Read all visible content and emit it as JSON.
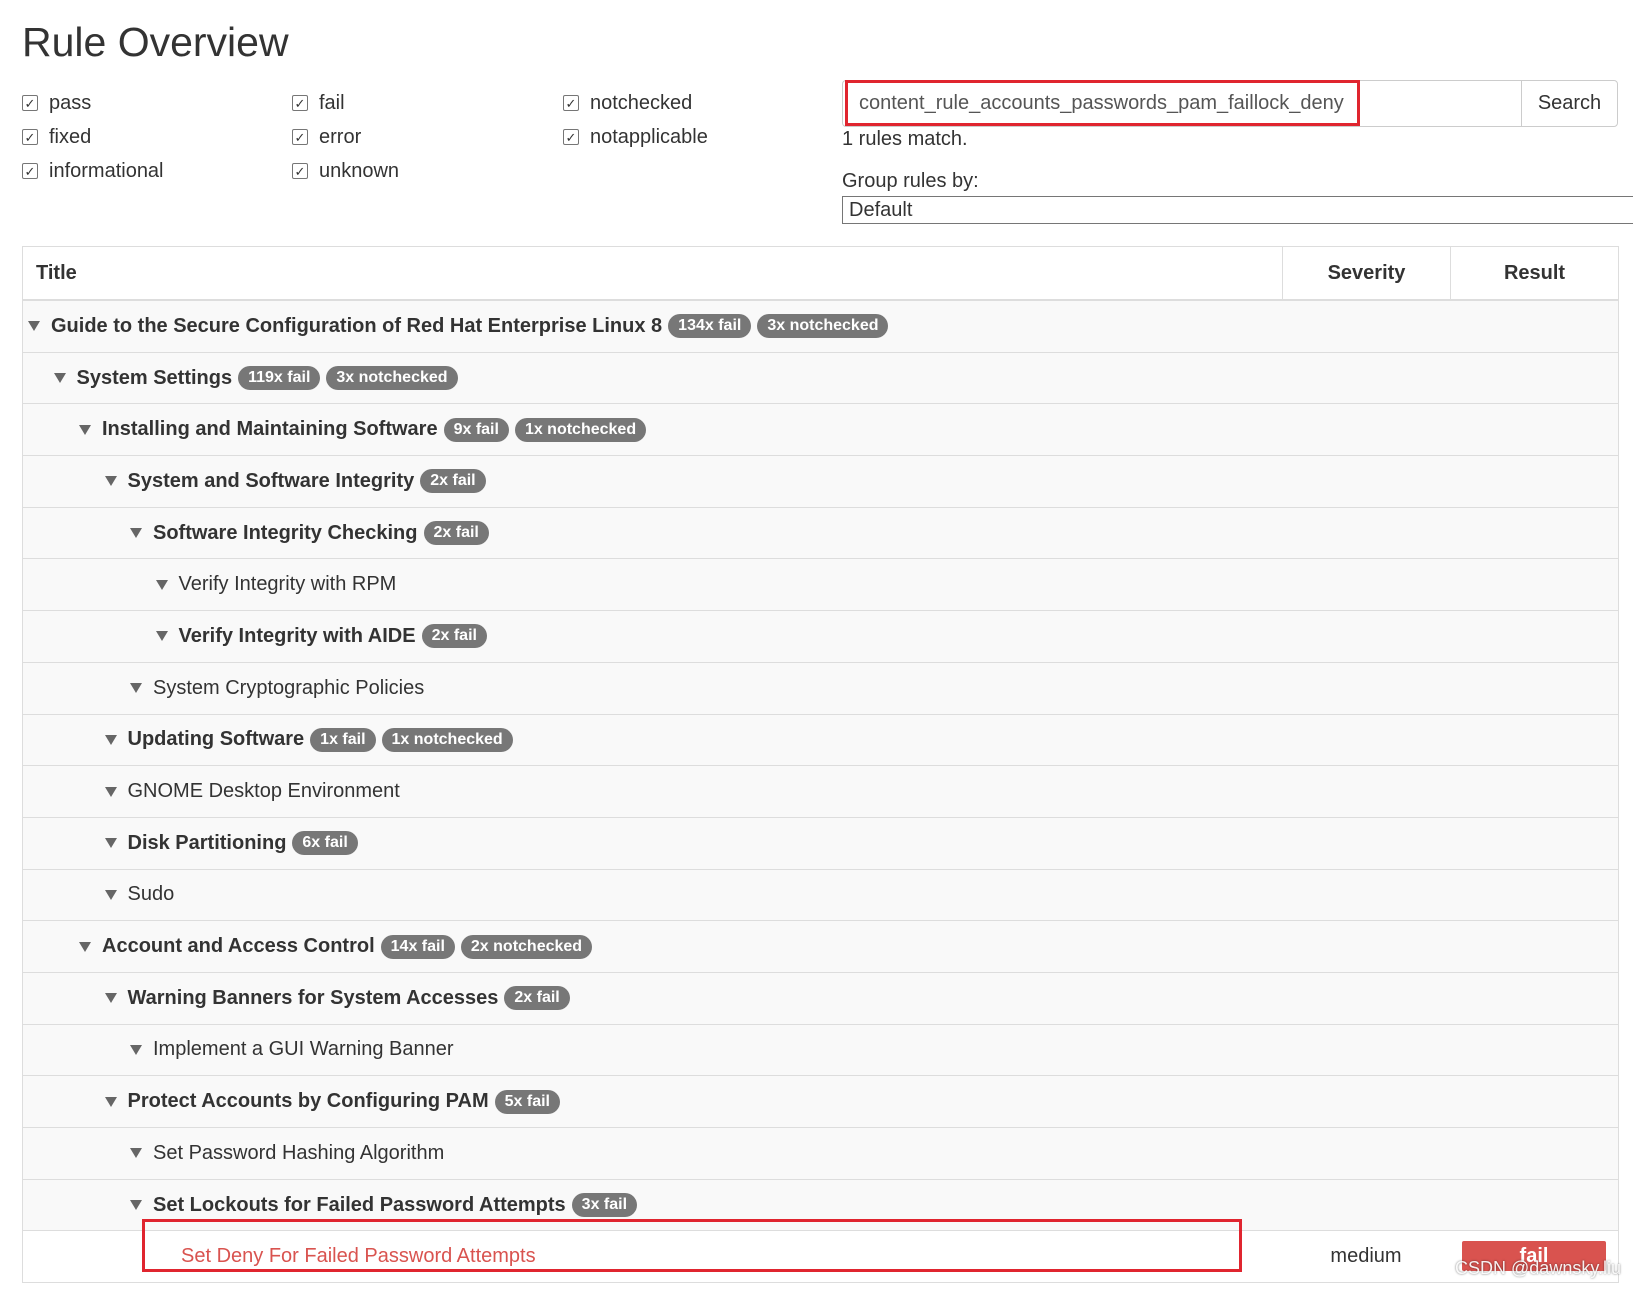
{
  "page_title": "Rule Overview",
  "filters": [
    {
      "label": "pass",
      "checked": true
    },
    {
      "label": "fixed",
      "checked": true
    },
    {
      "label": "informational",
      "checked": true
    },
    {
      "label": "fail",
      "checked": true
    },
    {
      "label": "error",
      "checked": true
    },
    {
      "label": "unknown",
      "checked": true
    },
    {
      "label": "notchecked",
      "checked": true
    },
    {
      "label": "notapplicable",
      "checked": true
    }
  ],
  "search": {
    "value": "content_rule_accounts_passwords_pam_faillock_deny",
    "button_label": "Search",
    "match_count": "1 rules match."
  },
  "group_by": {
    "label": "Group rules by:",
    "value": "Default"
  },
  "table": {
    "headers": {
      "title": "Title",
      "severity": "Severity",
      "result": "Result"
    },
    "groups": [
      {
        "label": "Guide to the Secure Configuration of Red Hat Enterprise Linux 8",
        "depth": 0,
        "bold": true,
        "badges": [
          "134x fail",
          "3x notchecked"
        ]
      },
      {
        "label": "System Settings",
        "depth": 1,
        "bold": true,
        "badges": [
          "119x fail",
          "3x notchecked"
        ]
      },
      {
        "label": "Installing and Maintaining Software",
        "depth": 2,
        "bold": true,
        "badges": [
          "9x fail",
          "1x notchecked"
        ]
      },
      {
        "label": "System and Software Integrity",
        "depth": 3,
        "bold": true,
        "badges": [
          "2x fail"
        ]
      },
      {
        "label": "Software Integrity Checking",
        "depth": 4,
        "bold": true,
        "badges": [
          "2x fail"
        ]
      },
      {
        "label": "Verify Integrity with RPM",
        "depth": 5,
        "bold": false,
        "badges": []
      },
      {
        "label": "Verify Integrity with AIDE",
        "depth": 5,
        "bold": true,
        "badges": [
          "2x fail"
        ]
      },
      {
        "label": "System Cryptographic Policies",
        "depth": 4,
        "bold": false,
        "badges": []
      },
      {
        "label": "Updating Software",
        "depth": 3,
        "bold": true,
        "badges": [
          "1x fail",
          "1x notchecked"
        ]
      },
      {
        "label": "GNOME Desktop Environment",
        "depth": 3,
        "bold": false,
        "badges": []
      },
      {
        "label": "Disk Partitioning",
        "depth": 3,
        "bold": true,
        "badges": [
          "6x fail"
        ]
      },
      {
        "label": "Sudo",
        "depth": 3,
        "bold": false,
        "badges": []
      },
      {
        "label": "Account and Access Control",
        "depth": 2,
        "bold": true,
        "badges": [
          "14x fail",
          "2x notchecked"
        ]
      },
      {
        "label": "Warning Banners for System Accesses",
        "depth": 3,
        "bold": true,
        "badges": [
          "2x fail"
        ]
      },
      {
        "label": "Implement a GUI Warning Banner",
        "depth": 4,
        "bold": false,
        "badges": []
      },
      {
        "label": "Protect Accounts by Configuring PAM",
        "depth": 3,
        "bold": true,
        "badges": [
          "5x fail"
        ]
      },
      {
        "label": "Set Password Hashing Algorithm",
        "depth": 4,
        "bold": false,
        "badges": []
      },
      {
        "label": "Set Lockouts for Failed Password Attempts",
        "depth": 4,
        "bold": true,
        "badges": [
          "3x fail"
        ]
      }
    ],
    "rule": {
      "title": "Set Deny For Failed Password Attempts",
      "severity": "medium",
      "result": "fail"
    }
  },
  "watermark": "CSDN @dawnsky.liu",
  "colors": {
    "badge": "#777777",
    "fail": "#d9534f",
    "highlight_box": "#e0252f",
    "row_bg": "#f9f9f9"
  }
}
